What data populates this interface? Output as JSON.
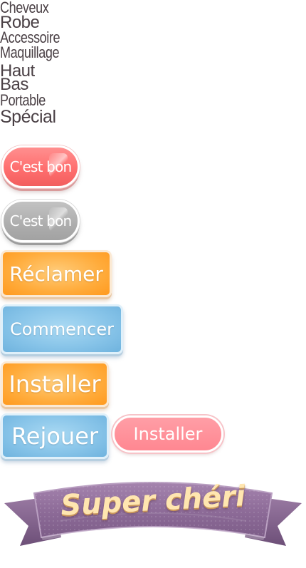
{
  "categories": [
    "Cheveux",
    "Robe",
    "Accessoire",
    "Maquillage",
    "Haut",
    "Bas",
    "Portable",
    "Spécial"
  ],
  "buttons": {
    "ok_red": "C'est bon",
    "ok_gray": "C'est bon",
    "claim": "Réclamer",
    "start": "Commencer",
    "install_orange": "Installer",
    "replay": "Rejouer",
    "install_pink": "Installer"
  },
  "banner": {
    "text": "Super chéri"
  },
  "colors": {
    "red_pill": "#ff7a7a",
    "gray_pill": "#b3b3b3",
    "orange": "#ffac3c",
    "blue": "#86c3e8",
    "pink": "#ff8f98",
    "ribbon": "#8e6a98",
    "banner_text": "#ffe6b0"
  }
}
